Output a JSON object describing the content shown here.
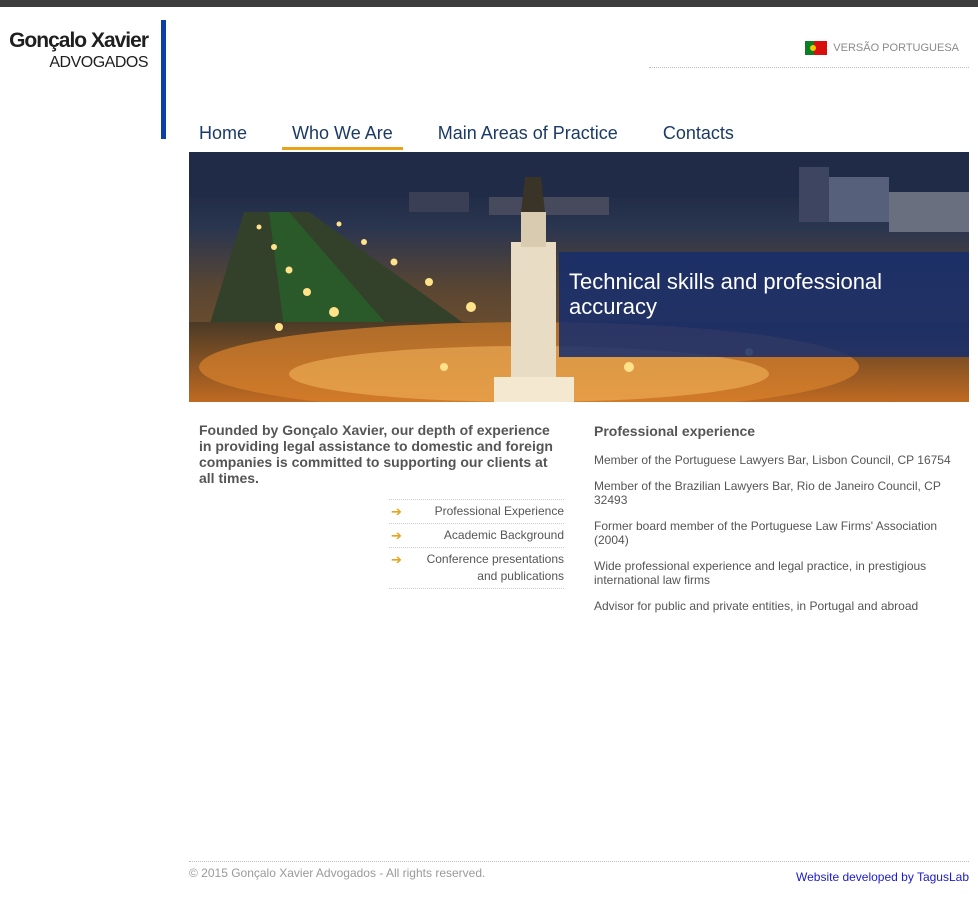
{
  "logo": {
    "name": "Gonçalo Xavier",
    "sub": "ADVOGADOS"
  },
  "language": {
    "label": "VERSÃO PORTUGUESA",
    "flag_icon": "portugal-flag-icon"
  },
  "nav": {
    "items": [
      {
        "label": "Home"
      },
      {
        "label": "Who We Are"
      },
      {
        "label": "Main Areas of Practice"
      },
      {
        "label": "Contacts"
      }
    ],
    "active": "Who We Are"
  },
  "banner": {
    "caption": "Technical skills and professional accuracy"
  },
  "intro": "Founded by Gonçalo Xavier, our depth of experience in providing legal assistance to domestic and foreign companies is committed to supporting our clients at all times.",
  "submenu": [
    {
      "label": "Professional Experience"
    },
    {
      "label": "Academic Background"
    },
    {
      "label": "Conference presentations and publications"
    }
  ],
  "experience": {
    "title": "Professional experience",
    "items": [
      "Member of the Portuguese Lawyers Bar, Lisbon Council, CP 16754",
      "Member of the Brazilian Lawyers Bar, Rio de Janeiro Council, CP 32493",
      "Former board member of the Portuguese Law Firms' Association (2004)",
      "Wide professional experience and legal practice, in prestigious international law firms",
      "Advisor for public and private entities, in Portugal and abroad"
    ]
  },
  "footer": {
    "copyright": "© 2015 Gonçalo Xavier Advogados - All rights reserved.",
    "credit": "Website developed by TagusLab"
  },
  "colors": {
    "accent": "#e8a21a",
    "brand_blue": "#0a3ea8",
    "nav_text": "#1b3a67",
    "caption_bg": "#162d6e"
  }
}
